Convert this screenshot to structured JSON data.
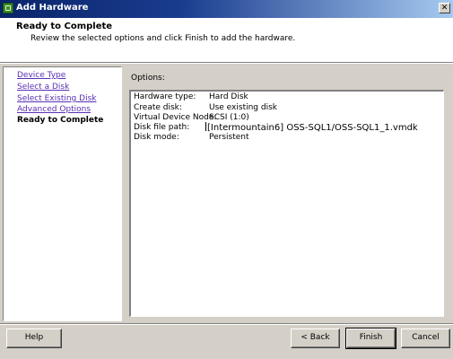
{
  "window": {
    "title": "Add Hardware",
    "close_glyph": "✕"
  },
  "header": {
    "title": "Ready to Complete",
    "subtitle": "Review the selected options and click Finish to add the hardware."
  },
  "nav": {
    "items": [
      {
        "label": "Device Type"
      },
      {
        "label": "Select a Disk"
      },
      {
        "label": "Select Existing Disk"
      },
      {
        "label": "Advanced Options"
      },
      {
        "label": "Ready to Complete"
      }
    ]
  },
  "options": {
    "label": "Options:",
    "rows": [
      {
        "label": "Hardware type:",
        "value": "Hard Disk"
      },
      {
        "label": "Create disk:",
        "value": "Use existing disk"
      },
      {
        "label": "Virtual Device Node:",
        "value": "SCSI (1:0)"
      },
      {
        "label": "Disk file path:",
        "value": "[Intermountain6] OSS-SQL1/OSS-SQL1_1.vmdk"
      },
      {
        "label": "Disk mode:",
        "value": "Persistent"
      }
    ]
  },
  "buttons": {
    "help": "Help",
    "back": "< Back",
    "finish": "Finish",
    "cancel": "Cancel"
  }
}
